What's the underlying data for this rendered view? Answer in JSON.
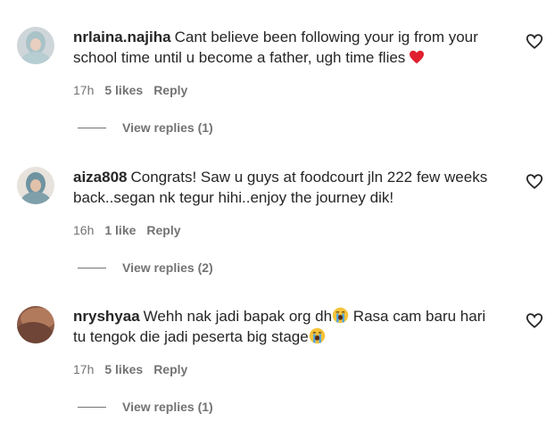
{
  "comments": [
    {
      "username": "nrlaina.najiha",
      "text": "Cant believe been following your ig from your school time until u become a father, ugh time flies",
      "emoji": "red-heart",
      "time": "17h",
      "likes": "5 likes",
      "reply_label": "Reply",
      "view_replies": "View replies (1)"
    },
    {
      "username": "aiza808",
      "text": "Congrats! Saw u guys at foodcourt jln 222 few weeks back..segan nk tegur hihi..enjoy the journey dik!",
      "time": "16h",
      "likes": "1 like",
      "reply_label": "Reply",
      "view_replies": "View replies (2)"
    },
    {
      "username": "nryshyaa",
      "text_part1": "Wehh nak jadi bapak org dh",
      "text_part2": " Rasa cam baru hari tu tengok die jadi peserta big stage",
      "emoji": "loudly-crying-face",
      "time": "17h",
      "likes": "5 likes",
      "reply_label": "Reply",
      "view_replies": "View replies (1)"
    }
  ]
}
